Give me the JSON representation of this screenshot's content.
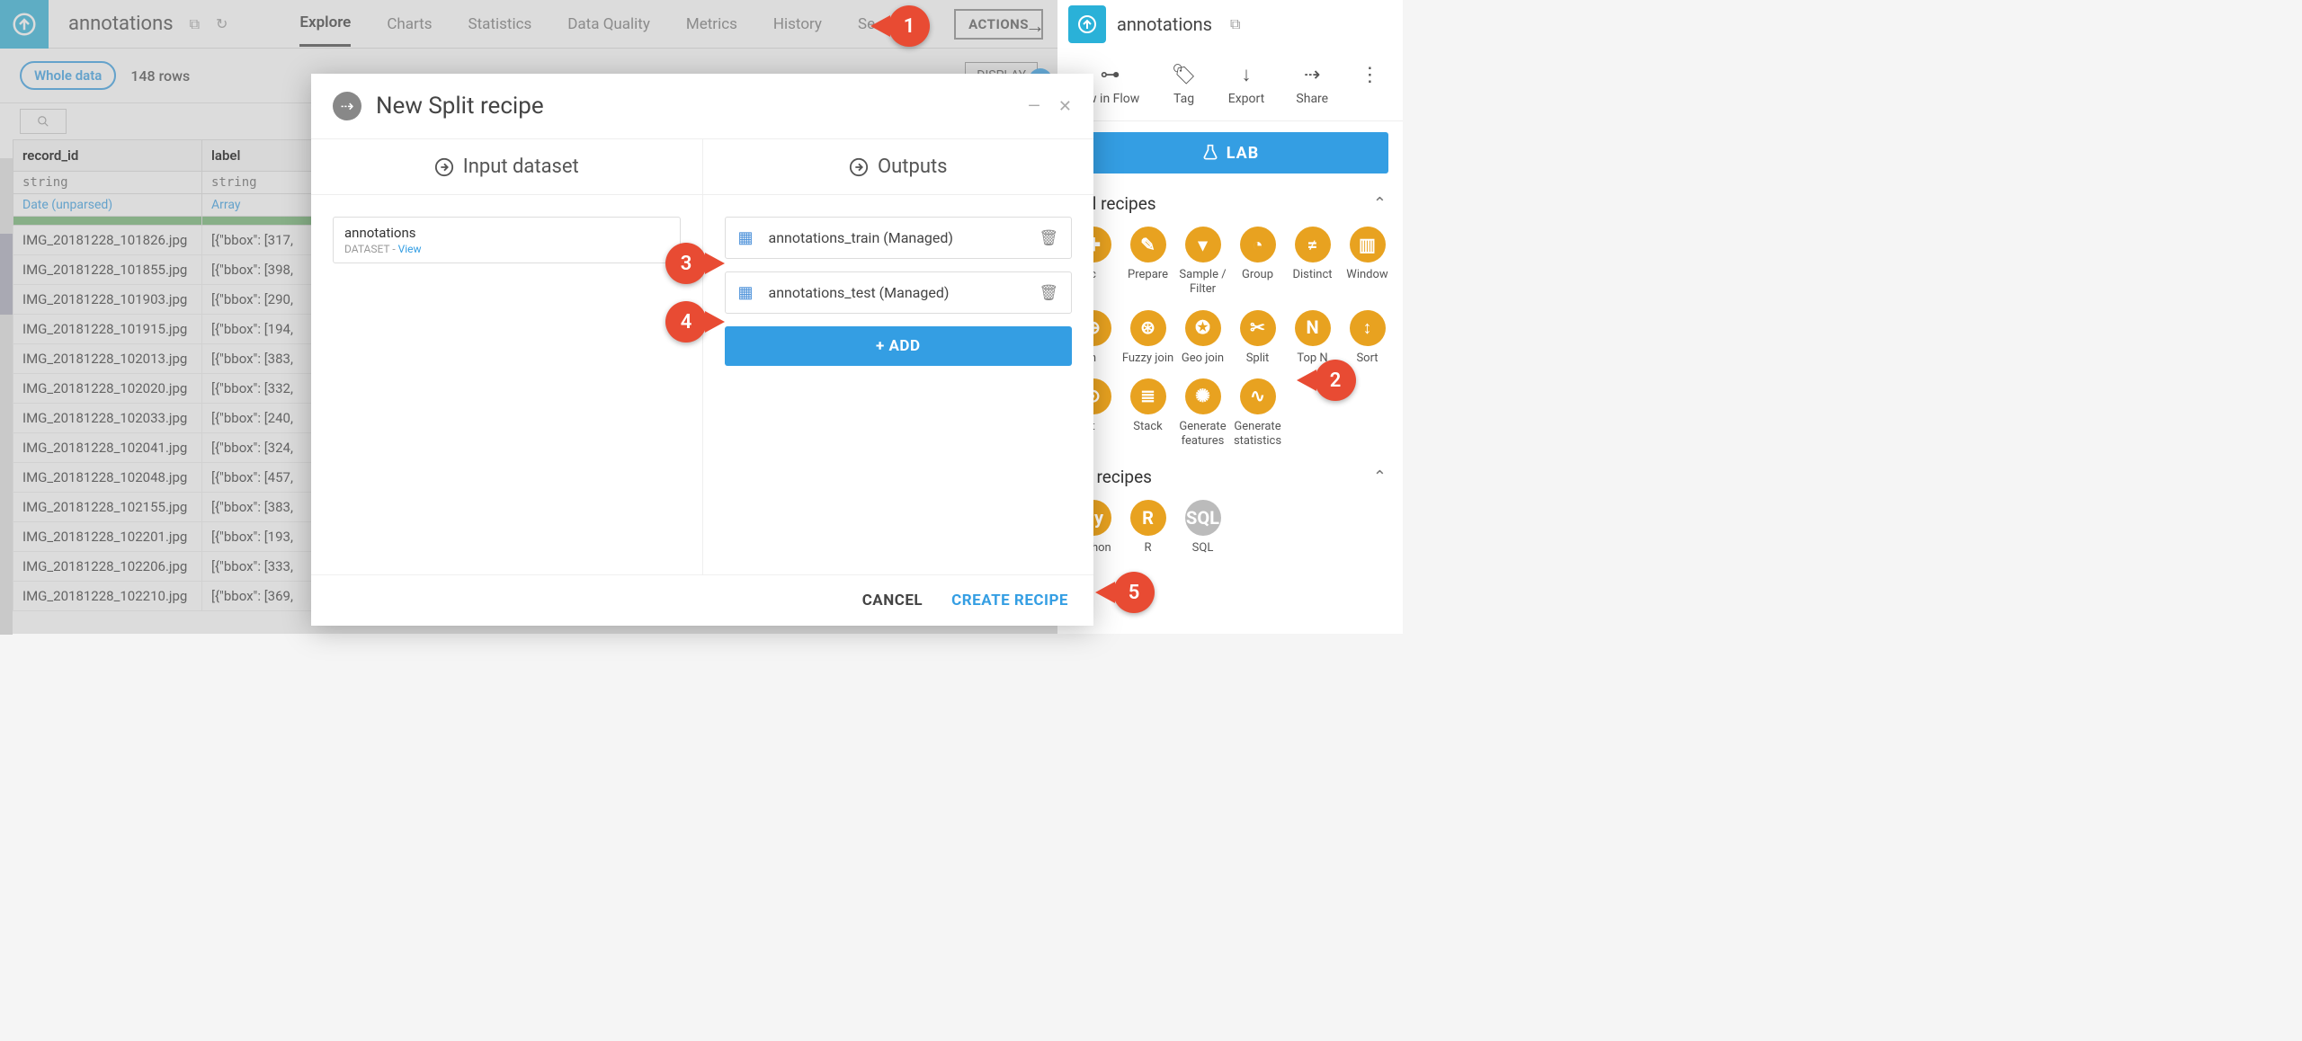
{
  "header": {
    "dataset_title": "annotations",
    "tabs": [
      "Explore",
      "Charts",
      "Statistics",
      "Data Quality",
      "Metrics",
      "History",
      "Se"
    ],
    "active_tab": "Explore",
    "actions_label": "ACTIONS"
  },
  "subbar": {
    "filter_pill": "Whole data",
    "row_count": "148 rows",
    "display_label": "DISPLAY"
  },
  "columns": [
    {
      "name": "record_id",
      "type": "string",
      "meaning": "Date (unparsed)"
    },
    {
      "name": "label",
      "type": "string",
      "meaning": "Array"
    }
  ],
  "rows": [
    {
      "record_id": "IMG_20181228_101826.jpg",
      "label": "[{\"bbox\": [317,"
    },
    {
      "record_id": "IMG_20181228_101855.jpg",
      "label": "[{\"bbox\": [398,"
    },
    {
      "record_id": "IMG_20181228_101903.jpg",
      "label": "[{\"bbox\": [290,"
    },
    {
      "record_id": "IMG_20181228_101915.jpg",
      "label": "[{\"bbox\": [194,"
    },
    {
      "record_id": "IMG_20181228_102013.jpg",
      "label": "[{\"bbox\": [383,"
    },
    {
      "record_id": "IMG_20181228_102020.jpg",
      "label": "[{\"bbox\": [332,"
    },
    {
      "record_id": "IMG_20181228_102033.jpg",
      "label": "[{\"bbox\": [240,"
    },
    {
      "record_id": "IMG_20181228_102041.jpg",
      "label": "[{\"bbox\": [324,"
    },
    {
      "record_id": "IMG_20181228_102048.jpg",
      "label": "[{\"bbox\": [457,"
    },
    {
      "record_id": "IMG_20181228_102155.jpg",
      "label": "[{\"bbox\": [383,"
    },
    {
      "record_id": "IMG_20181228_102201.jpg",
      "label": "[{\"bbox\": [193,"
    },
    {
      "record_id": "IMG_20181228_102206.jpg",
      "label": "[{\"bbox\": [333,"
    },
    {
      "record_id": "IMG_20181228_102210.jpg",
      "label": "[{\"bbox\": [369,"
    }
  ],
  "modal": {
    "title": "New Split recipe",
    "input_col_label": "Input dataset",
    "output_col_label": "Outputs",
    "input_dataset": {
      "name": "annotations",
      "type_label": "DATASET",
      "view_label": "View"
    },
    "outputs": [
      {
        "name": "annotations_train (Managed)"
      },
      {
        "name": "annotations_test (Managed)"
      }
    ],
    "add_label": "+ ADD",
    "cancel_label": "CANCEL",
    "create_label": "CREATE RECIPE"
  },
  "right_panel": {
    "title": "annotations",
    "actions": [
      {
        "label": "ew in Flow",
        "icon": "flow"
      },
      {
        "label": "Tag",
        "icon": "tag"
      },
      {
        "label": "Export",
        "icon": "download"
      },
      {
        "label": "Share",
        "icon": "share"
      }
    ],
    "lab_label": "LAB",
    "visual_section": "ual recipes",
    "code_section": "de recipes",
    "visual_recipes_row1": [
      {
        "label": "c",
        "icon": "✚"
      },
      {
        "label": "Prepare",
        "icon": "✎"
      },
      {
        "label": "Sample / Filter",
        "icon": "▾"
      },
      {
        "label": "Group",
        "icon": "◔"
      },
      {
        "label": "Distinct",
        "icon": "≠"
      },
      {
        "label": "Window",
        "icon": "▥"
      }
    ],
    "visual_recipes_row2": [
      {
        "label": "n",
        "icon": "⊕"
      },
      {
        "label": "Fuzzy join",
        "icon": "⊛"
      },
      {
        "label": "Geo join",
        "icon": "✪"
      },
      {
        "label": "Split",
        "icon": "✂"
      },
      {
        "label": "Top N",
        "icon": "N"
      },
      {
        "label": "Sort",
        "icon": "↕"
      }
    ],
    "visual_recipes_row3": [
      {
        "label": "t",
        "icon": "⊙"
      },
      {
        "label": "Stack",
        "icon": "≣"
      },
      {
        "label": "Generate features",
        "icon": "✺"
      },
      {
        "label": "Generate statistics",
        "icon": "∿"
      }
    ],
    "code_recipes": [
      {
        "label": "Python",
        "icon": "Py"
      },
      {
        "label": "R",
        "icon": "R"
      },
      {
        "label": "SQL",
        "icon": "SQL",
        "grey": true
      }
    ]
  },
  "bubbles": {
    "1": "1",
    "2": "2",
    "3": "3",
    "4": "4",
    "5": "5"
  },
  "colors": {
    "accent_blue": "#349ee3",
    "accent_orange": "#e8a220",
    "bubble_red": "#e84b33",
    "app_teal": "#2ab1d8"
  }
}
